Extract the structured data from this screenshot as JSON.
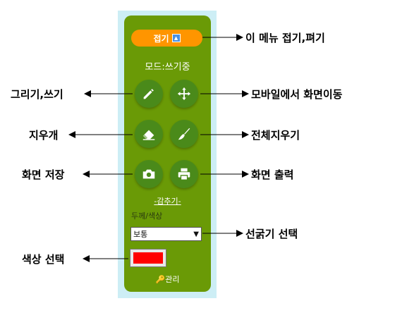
{
  "panel": {
    "collapse_label": "접기",
    "mode_text": "모드:쓰기중",
    "hide_link": "-감추기-",
    "thickness_label": "두께/색상",
    "thickness_select": "보통",
    "color_value": "#ff0000",
    "manage_label": "관리"
  },
  "callouts": {
    "collapse": "이 메뉴 접기,펴기",
    "draw": "그리기,쓰기",
    "move": "모바일에서 화면이동",
    "eraser": "지우개",
    "clear_all": "전체지우기",
    "save": "화면 저장",
    "print": "화면 출력",
    "line_width": "선굵기 선택",
    "color": "색상 선택"
  }
}
